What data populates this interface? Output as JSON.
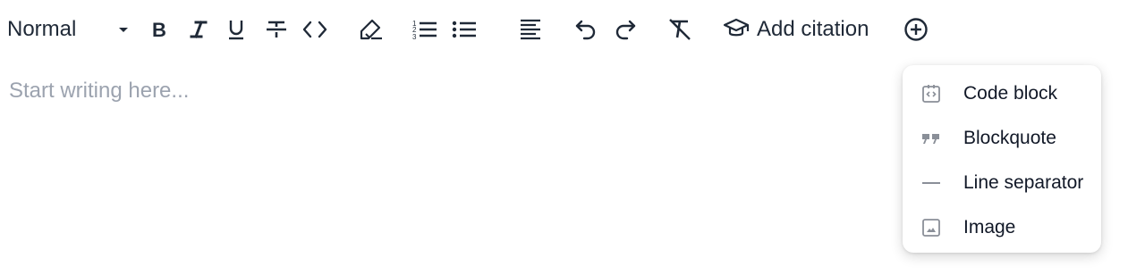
{
  "toolbar": {
    "text_style": {
      "selected": "Normal",
      "caret_icon": "caret-down-icon"
    },
    "buttons": [
      {
        "name": "bold",
        "icon": "bold-icon"
      },
      {
        "name": "italic",
        "icon": "italic-icon"
      },
      {
        "name": "underline",
        "icon": "underline-icon"
      },
      {
        "name": "strikethrough",
        "icon": "strikethrough-icon"
      },
      {
        "name": "inline-code",
        "icon": "code-icon"
      },
      {
        "name": "highlight",
        "icon": "highlighter-icon"
      },
      {
        "name": "ordered-list",
        "icon": "numbered-list-icon"
      },
      {
        "name": "bullet-list",
        "icon": "bullet-list-icon"
      },
      {
        "name": "align",
        "icon": "align-left-icon"
      },
      {
        "name": "undo",
        "icon": "undo-icon"
      },
      {
        "name": "redo",
        "icon": "redo-icon"
      },
      {
        "name": "clear-format",
        "icon": "clear-format-icon"
      }
    ],
    "citation": {
      "label": "Add citation",
      "icon": "graduation-cap-icon"
    },
    "insert": {
      "icon": "plus-circle-icon"
    }
  },
  "editor": {
    "placeholder": "Start writing here..."
  },
  "insert_menu": {
    "items": [
      {
        "label": "Code block",
        "icon": "code-block-icon"
      },
      {
        "label": "Blockquote",
        "icon": "quote-icon"
      },
      {
        "label": "Line separator",
        "icon": "horizontal-rule-icon"
      },
      {
        "label": "Image",
        "icon": "image-icon"
      }
    ]
  },
  "colors": {
    "text": "#1f2937",
    "placeholder": "#9ca3af",
    "menu_icon": "#8a8f98",
    "background": "#ffffff"
  }
}
